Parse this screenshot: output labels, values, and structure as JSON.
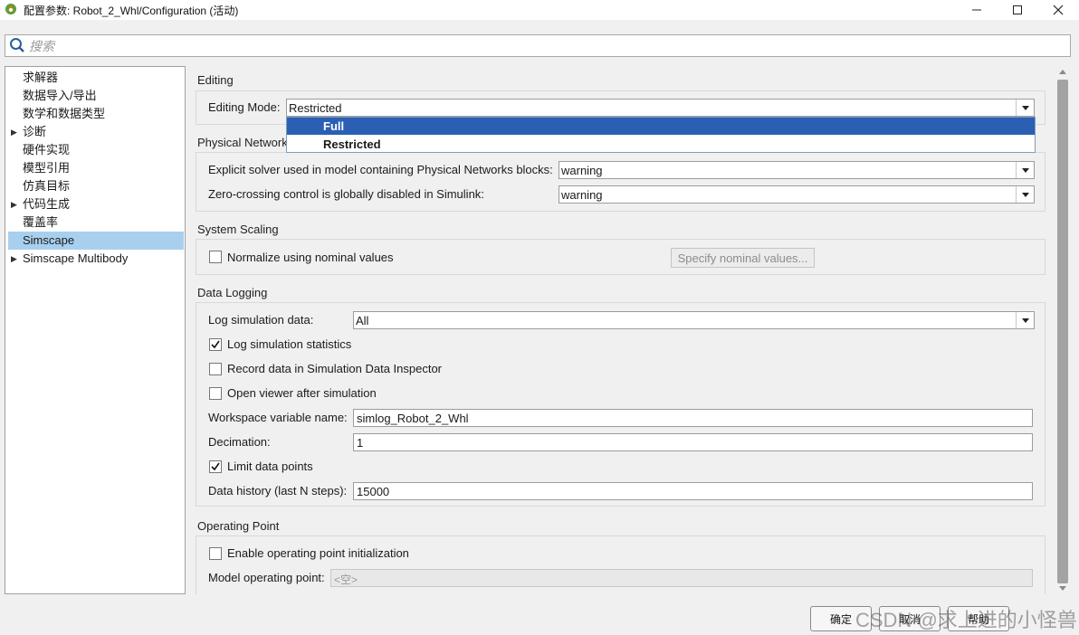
{
  "window": {
    "title": "配置参数: Robot_2_Whl/Configuration (活动)",
    "minimize": "—",
    "maximize": "☐",
    "close": "✕"
  },
  "search": {
    "placeholder": "搜索",
    "icon": "search-icon"
  },
  "tree": {
    "items": [
      {
        "label": "求解器",
        "expandable": false,
        "selected": false
      },
      {
        "label": "数据导入/导出",
        "expandable": false,
        "selected": false
      },
      {
        "label": "数学和数据类型",
        "expandable": false,
        "selected": false
      },
      {
        "label": "诊断",
        "expandable": true,
        "selected": false
      },
      {
        "label": "硬件实现",
        "expandable": false,
        "selected": false
      },
      {
        "label": "模型引用",
        "expandable": false,
        "selected": false
      },
      {
        "label": "仿真目标",
        "expandable": false,
        "selected": false
      },
      {
        "label": "代码生成",
        "expandable": true,
        "selected": false
      },
      {
        "label": "覆盖率",
        "expandable": false,
        "selected": false
      },
      {
        "label": "Simscape",
        "expandable": false,
        "selected": true
      },
      {
        "label": "Simscape Multibody",
        "expandable": true,
        "selected": false
      }
    ]
  },
  "editing": {
    "section_title": "Editing",
    "mode_label": "Editing Mode:",
    "mode_value": "Restricted",
    "options": [
      "Full",
      "Restricted"
    ],
    "highlighted_option": "Full"
  },
  "physical_network": {
    "section_title": "Physical Network",
    "explicit_solver_label": "Explicit solver used in model containing Physical Networks blocks:",
    "explicit_solver_value": "warning",
    "zero_crossing_label": "Zero-crossing control is globally disabled in Simulink:",
    "zero_crossing_value": "warning"
  },
  "system_scaling": {
    "section_title": "System Scaling",
    "normalize_label": "Normalize using nominal values",
    "normalize_checked": false,
    "specify_button": "Specify nominal values..."
  },
  "data_logging": {
    "section_title": "Data Logging",
    "log_data_label": "Log simulation data:",
    "log_data_value": "All",
    "log_stats_label": "Log simulation statistics",
    "log_stats_checked": true,
    "record_label": "Record data in Simulation Data Inspector",
    "record_checked": false,
    "open_viewer_label": "Open viewer after simulation",
    "open_viewer_checked": false,
    "workspace_label": "Workspace variable name:",
    "workspace_value": "simlog_Robot_2_Whl",
    "decimation_label": "Decimation:",
    "decimation_value": "1",
    "limit_label": "Limit data points",
    "limit_checked": true,
    "history_label": "Data history (last N steps):",
    "history_value": "15000"
  },
  "operating_point": {
    "section_title": "Operating Point",
    "enable_label": "Enable operating point initialization",
    "enable_checked": false,
    "model_op_label": "Model operating point:",
    "model_op_value": "<空>"
  },
  "footer": {
    "ok": "确定",
    "cancel": "取消",
    "help": "帮助"
  },
  "watermark": "CSDN @求上进的小怪兽"
}
